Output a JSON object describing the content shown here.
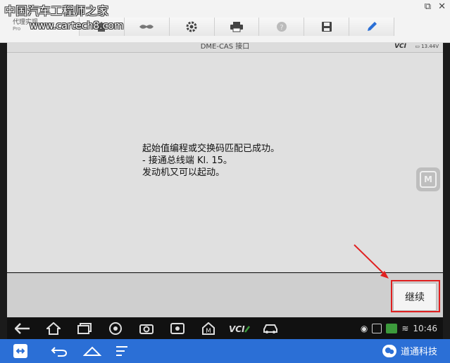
{
  "watermark": {
    "title": "中国汽车工程师之家",
    "url": "www.cartech8.com"
  },
  "app": {
    "label": "代理实现",
    "sub": "Pro"
  },
  "header": {
    "title": "DME-CAS 接口",
    "vci": "VCI",
    "battery": "13.44V"
  },
  "toolbar": {
    "items": [
      {
        "icon": "home-icon"
      },
      {
        "icon": "handshake-icon"
      },
      {
        "icon": "gear-icon"
      },
      {
        "icon": "printer-icon"
      },
      {
        "icon": "help-icon"
      },
      {
        "icon": "save-icon"
      },
      {
        "icon": "pen-icon"
      }
    ]
  },
  "message": {
    "line1": "起始值编程或交换码匹配已成功。",
    "line2": "- 接通总线端 Kl. 15。",
    "line3": "发动机又可以起动。"
  },
  "side_button": {
    "label": "M"
  },
  "actions": {
    "continue_label": "继续"
  },
  "status": {
    "time": "10:46"
  },
  "brand": {
    "name": "道通科技"
  },
  "colors": {
    "highlight": "#e02020",
    "osbar": "#2b6fd6"
  }
}
